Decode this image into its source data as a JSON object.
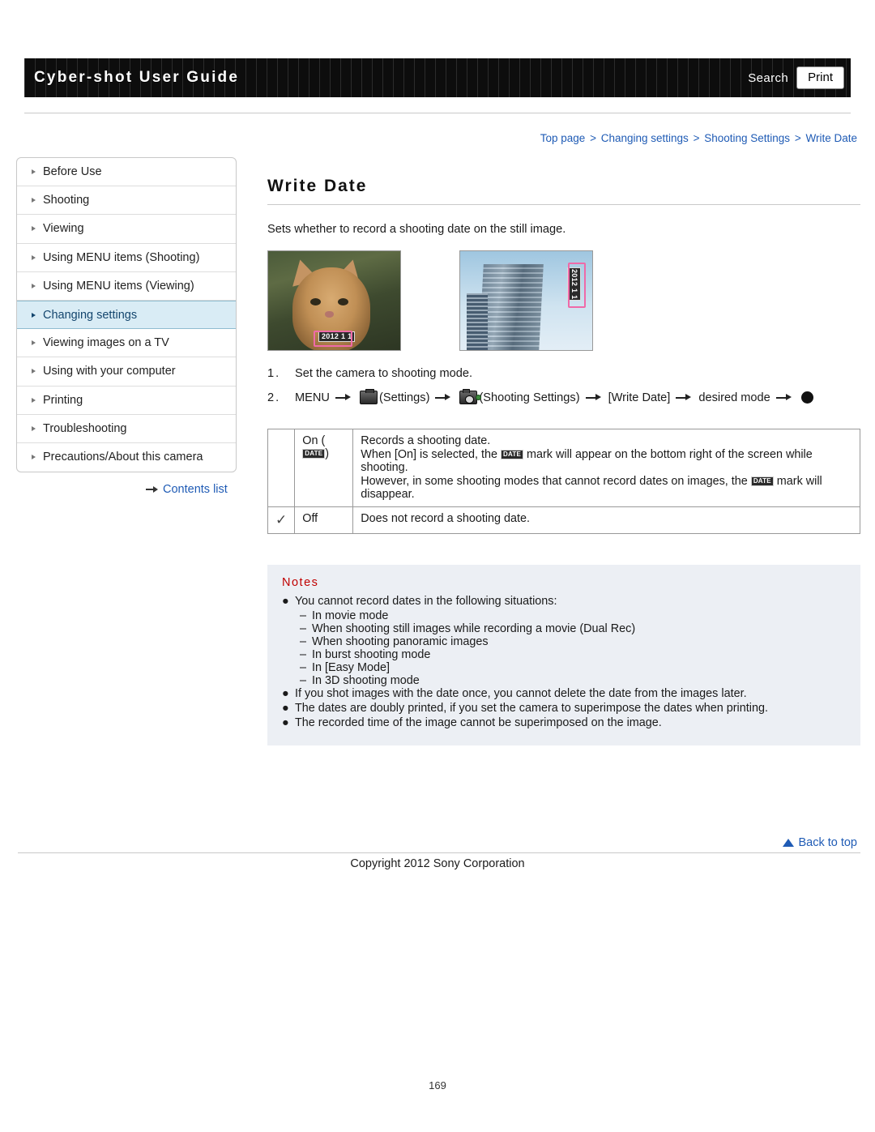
{
  "header": {
    "title": "Cyber-shot User Guide",
    "search_label": "Search",
    "print_label": "Print"
  },
  "breadcrumb": {
    "items": [
      "Top page",
      "Changing settings",
      "Shooting Settings",
      "Write Date"
    ],
    "separator": ">"
  },
  "sidebar": {
    "items": [
      {
        "label": "Before Use"
      },
      {
        "label": "Shooting"
      },
      {
        "label": "Viewing"
      },
      {
        "label": "Using MENU items (Shooting)"
      },
      {
        "label": "Using MENU items (Viewing)"
      },
      {
        "label": "Changing settings"
      },
      {
        "label": "Viewing images on a TV"
      },
      {
        "label": "Using with your computer"
      },
      {
        "label": "Printing"
      },
      {
        "label": "Troubleshooting"
      },
      {
        "label": "Precautions/About this camera"
      }
    ],
    "contents_list": "Contents list"
  },
  "main": {
    "title": "Write Date",
    "intro": "Sets whether to record a shooting date on the still image.",
    "photo_cat_date": "2012 1 1",
    "photo_bldg_date": "2012 1 1",
    "steps": [
      {
        "num": "1.",
        "text": "Set the camera to shooting mode."
      },
      {
        "num": "2.",
        "menu": "MENU",
        "settings": "(Settings)",
        "shooting_settings": "(Shooting Settings)",
        "write_date": "[Write Date]",
        "desired_mode": "desired mode"
      }
    ],
    "table": {
      "rows": [
        {
          "checked": false,
          "label": "On (",
          "label_suffix": ")",
          "chip": "DATE",
          "lines": [
            "Records a shooting date.",
            "When [On] is selected, the  mark will appear on the bottom right of the screen while shooting.",
            "However, in some shooting modes that cannot record dates on images, the  mark will disappear."
          ],
          "line2_a": "When [On] is selected, the",
          "line2_b": "mark will appear on the bottom right of the screen while",
          "line2_c": "shooting.",
          "line3_a": "However, in some shooting modes that cannot record dates on images, the",
          "line3_b": "mark will",
          "line3_c": "disappear."
        },
        {
          "checked": true,
          "label": "Off",
          "lines": [
            "Does not record a shooting date."
          ]
        }
      ]
    },
    "notes": {
      "title": "Notes",
      "items": [
        {
          "text": "You cannot record dates in the following situations:",
          "subs": [
            "In movie mode",
            "When shooting still images while recording a movie (Dual Rec)",
            "When shooting panoramic images",
            "In burst shooting mode",
            "In [Easy Mode]",
            "In 3D shooting mode"
          ]
        },
        {
          "text": "If you shot images with the date once, you cannot delete the date from the images later.",
          "subs": []
        },
        {
          "text": "The dates are doubly printed, if you set the camera to superimpose the dates when printing.",
          "subs": []
        },
        {
          "text": "The recorded time of the image cannot be superimposed on the image.",
          "subs": []
        }
      ]
    }
  },
  "footer": {
    "back_to_top": "Back to top",
    "copyright": "Copyright 2012 Sony Corporation",
    "page_number": "169"
  }
}
